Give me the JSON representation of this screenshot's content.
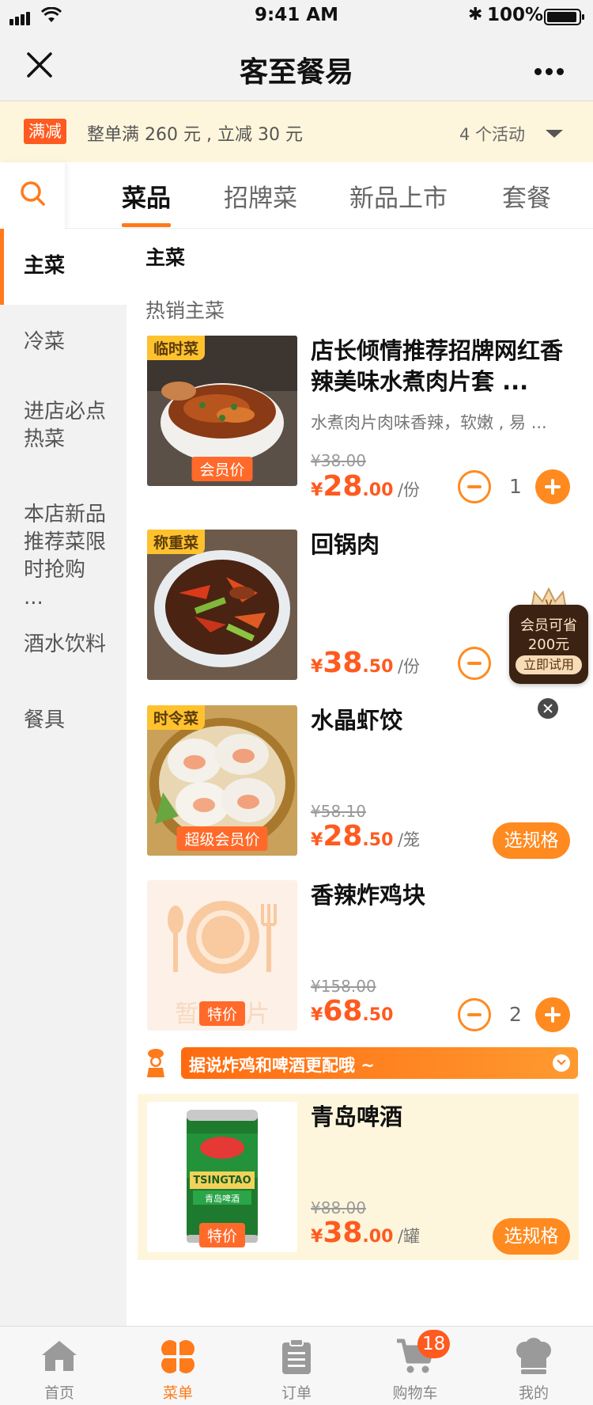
{
  "status_bar": {
    "time": "9:41 AM",
    "battery": "100%"
  },
  "nav": {
    "title": "客至餐易"
  },
  "promo": {
    "tag": "满减",
    "text": "整单满 260 元 , 立减 30 元",
    "count": "4 个活动"
  },
  "tabs": [
    "菜品",
    "招牌菜",
    "新品上市",
    "套餐"
  ],
  "sidebar": [
    {
      "label": "主菜",
      "active": true
    },
    {
      "label": "冷菜"
    },
    {
      "label": "进店必点热菜"
    },
    {
      "label": "本店新品推荐菜限时抢购 ..."
    },
    {
      "label": "酒水饮料"
    },
    {
      "label": "餐具"
    }
  ],
  "section": {
    "title": "主菜",
    "subtitle": "热销主菜"
  },
  "items": [
    {
      "tag": "临时菜",
      "img_label": "会员价",
      "name": "店长倾情推荐招牌网红香辣美味水煮肉片套 ...",
      "desc": "水煮肉片肉味香辣，软嫩 , 易 ...",
      "old_price": "¥38.00",
      "currency": "¥",
      "price_int": "28",
      "price_dec": ".00",
      "unit": "/份",
      "quantity": "1"
    },
    {
      "tag": "称重菜",
      "name": "回锅肉",
      "currency": "¥",
      "price_int": "38",
      "price_dec": ".50",
      "unit": "/份"
    },
    {
      "tag": "时令菜",
      "img_label": "超级会员价",
      "name": "水晶虾饺",
      "old_price": "¥58.10",
      "currency": "¥",
      "price_int": "28",
      "price_dec": ".50",
      "unit": "/笼",
      "button": "选规格"
    },
    {
      "img_label": "特价",
      "placeholder_text": "暂无图片",
      "name": "香辣炸鸡块",
      "old_price": "¥158.00",
      "currency": "¥",
      "price_int": "68",
      "price_dec": ".50",
      "quantity": "2"
    }
  ],
  "combo_tip": "据说炸鸡和啤酒更配哦 ~",
  "combo_item": {
    "img_label": "特价",
    "can_brand": "TSINGTAO",
    "can_cn": "青岛啤酒",
    "name": "青岛啤酒",
    "old_price": "¥88.00",
    "currency": "¥",
    "price_int": "38",
    "price_dec": ".00",
    "unit": "/罐",
    "button": "选规格"
  },
  "member_float": {
    "line1": "会员可省",
    "line2": "200元",
    "button": "立即试用"
  },
  "tabbar": [
    {
      "label": "首页",
      "icon": "home-icon"
    },
    {
      "label": "菜单",
      "icon": "menu-icon",
      "active": true
    },
    {
      "label": "订单",
      "icon": "order-icon"
    },
    {
      "label": "购物车",
      "icon": "cart-icon",
      "badge": "18"
    },
    {
      "label": "我的",
      "icon": "profile-icon"
    }
  ],
  "colors": {
    "accent": "#ff7a1a",
    "price": "#ff5a1f",
    "promo_bg": "#fef6dc",
    "tag_yellow": "#fec22f"
  }
}
